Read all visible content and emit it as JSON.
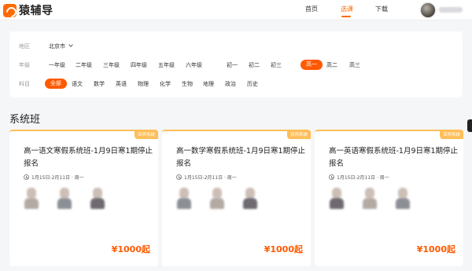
{
  "header": {
    "logo_text": "猿辅导",
    "nav": [
      {
        "label": "首页",
        "active": false
      },
      {
        "label": "选课",
        "active": true
      },
      {
        "label": "下载",
        "active": false
      }
    ],
    "accent_color": "#ff6a00"
  },
  "filters": {
    "region_label": "地区",
    "region_value": "北京市",
    "grade_label": "年级",
    "grades": [
      "一年级",
      "二年级",
      "三年级",
      "四年级",
      "五年级",
      "六年级",
      "初一",
      "初二",
      "初三",
      "高一",
      "高二",
      "高三"
    ],
    "selected_grade": "高一",
    "subject_label": "科目",
    "subjects": [
      "全部",
      "语文",
      "数学",
      "英语",
      "物理",
      "化学",
      "生物",
      "地理",
      "政治",
      "历史"
    ],
    "selected_subject": "全部"
  },
  "section": {
    "title": "系统班"
  },
  "cards": [
    {
      "tag": "双师系统",
      "title": "高一语文寒假系统班-1月9日寒1期停止报名",
      "time": "1月15日-2月11日 · 周一",
      "price": "¥1000起"
    },
    {
      "tag": "双师系统",
      "title": "高一数学寒假系统班-1月9日寒1期停止报名",
      "time": "1月15日-2月11日 · 周一",
      "price": "¥1000起"
    },
    {
      "tag": "双师系统",
      "title": "高一英语寒假系统班-1月9日寒1期停止报名",
      "time": "1月15日-2月11日 · 周一",
      "price": "¥1000起"
    }
  ]
}
